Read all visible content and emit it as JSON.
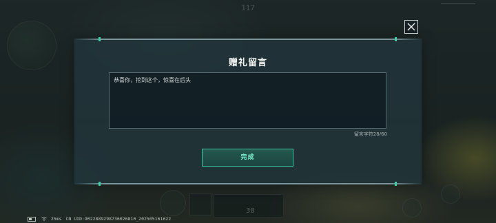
{
  "dialog": {
    "title": "赠礼留言",
    "message": "恭喜你，挖到这个，惊喜在后头",
    "char_count": "留言字符28/60",
    "done_label": "完成"
  },
  "hud": {
    "top_value": "117"
  },
  "status_bar": {
    "ping": "25ms",
    "uid": "CN UID:9022889298736026810_202505161622"
  },
  "ammo": {
    "count": "38"
  },
  "colors": {
    "accent": "#39c9a0",
    "panel": "#22363c",
    "text": "#f2f4f2"
  },
  "icons": {
    "close": "close-icon",
    "battery": "battery-icon",
    "wifi": "wifi-icon"
  }
}
